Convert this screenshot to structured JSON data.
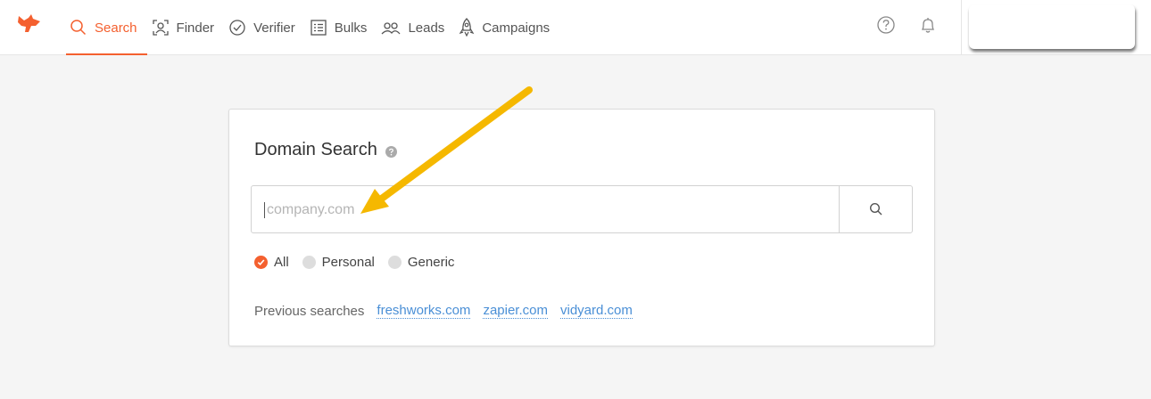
{
  "nav": {
    "items": [
      {
        "label": "Search",
        "icon": "search-icon",
        "active": true
      },
      {
        "label": "Finder",
        "icon": "finder-icon",
        "active": false
      },
      {
        "label": "Verifier",
        "icon": "check-circle-icon",
        "active": false
      },
      {
        "label": "Bulks",
        "icon": "list-icon",
        "active": false
      },
      {
        "label": "Leads",
        "icon": "people-icon",
        "active": false
      },
      {
        "label": "Campaigns",
        "icon": "rocket-icon",
        "active": false
      }
    ]
  },
  "card": {
    "title": "Domain Search",
    "search_placeholder": "company.com",
    "filters": [
      {
        "label": "All",
        "checked": true
      },
      {
        "label": "Personal",
        "checked": false
      },
      {
        "label": "Generic",
        "checked": false
      }
    ],
    "previous_label": "Previous searches",
    "previous_searches": [
      "freshworks.com",
      "zapier.com",
      "vidyard.com"
    ]
  },
  "colors": {
    "accent": "#f4602f",
    "link": "#4a8fd6",
    "annotation_arrow": "#f5b800"
  }
}
